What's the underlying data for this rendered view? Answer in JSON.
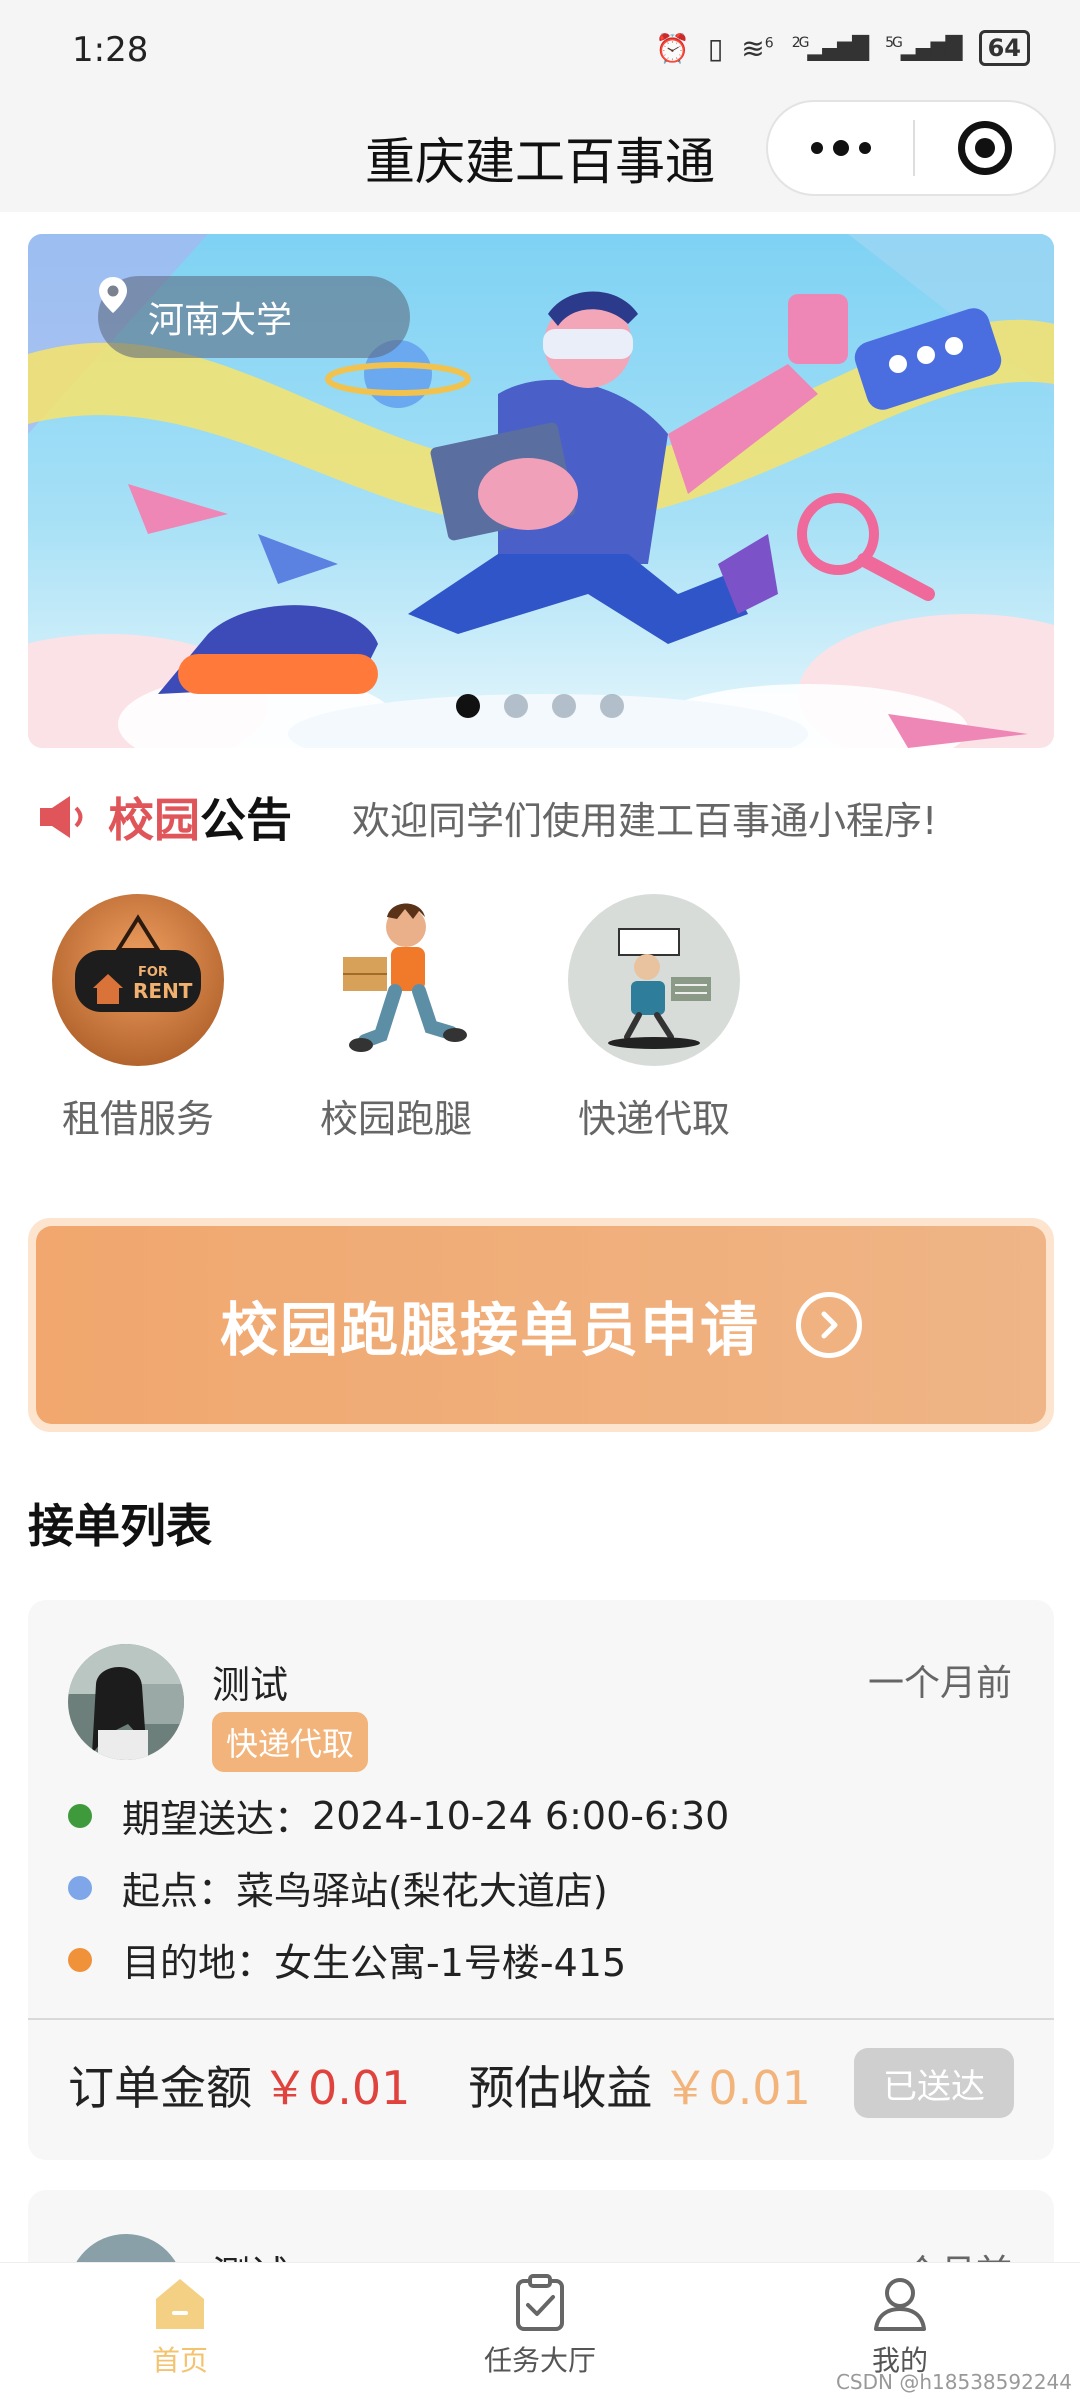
{
  "status_bar": {
    "time": "1:28",
    "battery": "64",
    "signal_1": "6",
    "signal_2": "2G",
    "signal_3": "5G"
  },
  "nav": {
    "title": "重庆建工百事通"
  },
  "banner": {
    "location": "河南大学",
    "dots_count": 4,
    "active_dot": 0
  },
  "notice": {
    "title_red": "校园",
    "title_black": "公告",
    "text": "欢迎同学们使用建工百事通小程序!"
  },
  "services": [
    {
      "label": "租借服务",
      "icon": "rent-sign-icon",
      "sign_line1": "FOR",
      "sign_line2": "RENT"
    },
    {
      "label": "校园跑腿",
      "icon": "runner-icon"
    },
    {
      "label": "快递代取",
      "icon": "courier-icon"
    }
  ],
  "apply": {
    "label": "校园跑腿接单员申请"
  },
  "section": {
    "title": "接单列表"
  },
  "orders": [
    {
      "user": "测试",
      "time_ago": "一个月前",
      "tag": "快递代取",
      "expected_label": "期望送达：",
      "expected_value": "2024-10-24 6:00-6:30",
      "start_label": "起点：",
      "start_value": "菜鸟驿站(梨花大道店)",
      "dest_label": "目的地：",
      "dest_value": "女生公寓-1号楼-415",
      "amount_label": "订单金额",
      "amount_value": "￥0.01",
      "income_label": "预估收益",
      "income_value": "￥0.01",
      "status": "已送达"
    },
    {
      "user": "测试",
      "time_ago": "一个月前"
    }
  ],
  "tabs": [
    {
      "label": "首页",
      "icon": "home-icon",
      "active": true
    },
    {
      "label": "任务大厅",
      "icon": "clipboard-check-icon",
      "active": false
    },
    {
      "label": "我的",
      "icon": "user-icon",
      "active": false
    }
  ],
  "colors": {
    "accent": "#f3c370",
    "notice_red": "#e05559",
    "price_red": "#e0433d",
    "apply_orange": "#f1a76e",
    "bullet_green": "#3f9a3b",
    "bullet_blue": "#7ea6e8",
    "bullet_orange": "#f0923a"
  },
  "watermark": "CSDN @h18538592244"
}
